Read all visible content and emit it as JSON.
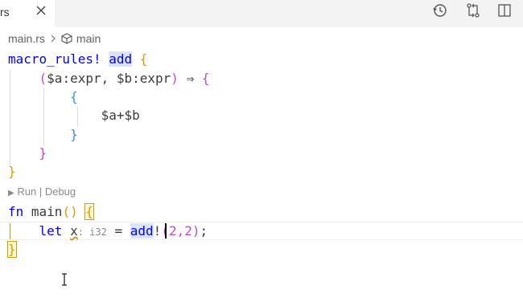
{
  "tab": {
    "label": "rs",
    "close_icon": "close-icon"
  },
  "toolbar": {
    "icons": [
      "history-icon",
      "compare-changes-icon",
      "split-editor-icon"
    ]
  },
  "breadcrumb": {
    "file": "main.rs",
    "symbol": "main",
    "symbol_icon": "cube-icon"
  },
  "codelens": {
    "run": "Run",
    "sep": "|",
    "debug": "Debug"
  },
  "code": {
    "l1_macro_rules": "macro_rules!",
    "l1_name": "add",
    "l1_open": "{",
    "l2_open": "(",
    "l2_args": "$a:expr, $b:expr",
    "l2_close": ")",
    "l2_arrow": "⇒",
    "l2_brace": "{",
    "l3_brace": "{",
    "l4_body": "$a+$b",
    "l5_brace": "}",
    "l6_brace": "}",
    "l7_brace": "}",
    "l8_fn": "fn",
    "l8_name": "main",
    "l8_parens": "()",
    "l8_brace": "{",
    "l9_let": "let",
    "l9_var": "x",
    "l9_hint": ": i32",
    "l9_eq": "=",
    "l9_macro": "add",
    "l9_bang": "!",
    "l9_args": "(2,2)",
    "l9_semi": ";",
    "l10_brace": "}"
  }
}
